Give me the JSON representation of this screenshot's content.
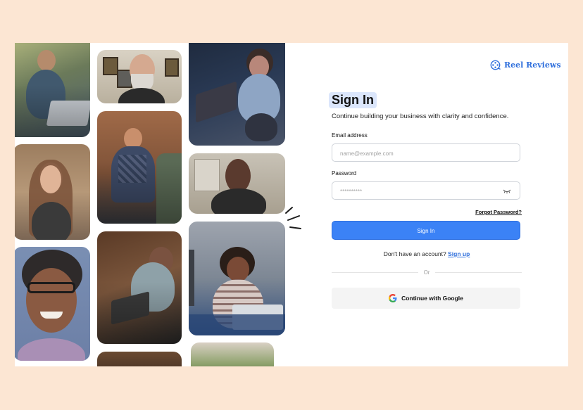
{
  "brand": {
    "name": "Reel Reviews",
    "icon": "film-reel-icon",
    "color": "#2f6fdc"
  },
  "form": {
    "title": "Sign In",
    "subtitle": "Continue building your business with clarity and confidence.",
    "email": {
      "label": "Email address",
      "placeholder": "name@example.com"
    },
    "password": {
      "label": "Password",
      "placeholder": "**********",
      "icon": "eye-closed-icon"
    },
    "forgot_label": "Forgot Password?",
    "submit_label": "Sign In",
    "signup_prompt": "Don't have an account?",
    "signup_link": "Sign up",
    "divider_label": "Or",
    "google_label": "Continue with Google",
    "accent": "#3b82f6"
  }
}
